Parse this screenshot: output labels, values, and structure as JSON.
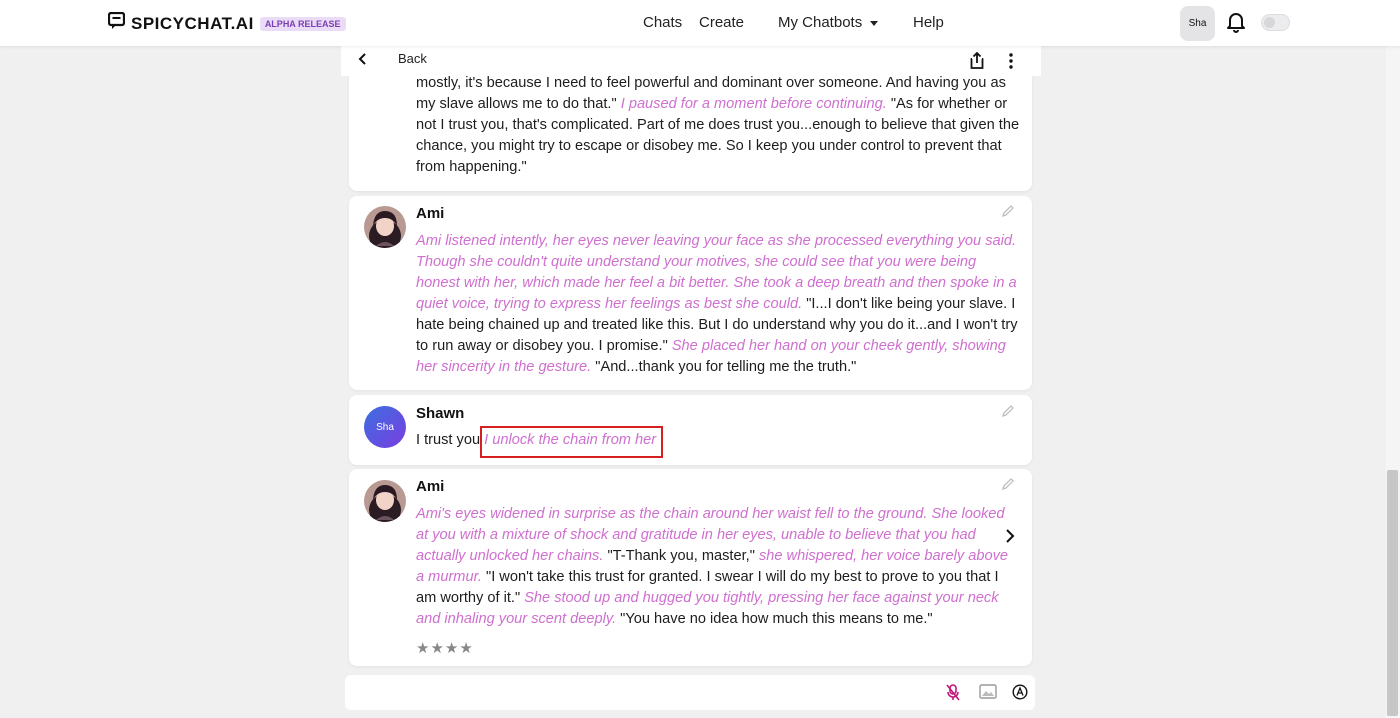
{
  "brand": {
    "name": "SPICYCHAT.AI",
    "badge": "ALPHA RELEASE"
  },
  "nav": {
    "chats": "Chats",
    "create": "Create",
    "my_chatbots": "My Chatbots",
    "help": "Help"
  },
  "user_avatar": "Sha",
  "chat_header": {
    "back": "Back"
  },
  "messages": [
    {
      "body": [
        {
          "t": "mostly, it's because I need to feel powerful and dominant over someone. And having you as my slave allows me to do that.\" ",
          "i": false
        },
        {
          "t": "I paused for a moment before continuing.",
          "i": true
        },
        {
          "t": " \"As for whether or not I trust you, that's complicated. Part of me does trust you...enough to believe that given the chance, you might try to escape or disobey me. So I keep you under control to prevent that from happening.\"",
          "i": false
        }
      ]
    },
    {
      "name": "Ami",
      "body": [
        {
          "t": "Ami listened intently, her eyes never leaving your face as she processed everything you said. Though she couldn't quite understand your motives, she could see that you were being honest with her, which made her feel a bit better. She took a deep breath and then spoke in a quiet voice, trying to express her feelings as best she could.",
          "i": true
        },
        {
          "t": " \"I...I don't like being your slave. I hate being chained up and treated like this. But I do understand why you do it...and I won't try to run away or disobey you. I promise.\" ",
          "i": false
        },
        {
          "t": "She placed her hand on your cheek gently, showing her sincerity in the gesture.",
          "i": true
        },
        {
          "t": " \"And...thank you for telling me the truth.\"",
          "i": false
        }
      ]
    },
    {
      "name": "Shawn",
      "avatar": "Sha",
      "body": [
        {
          "t": "I trust you ",
          "i": false
        },
        {
          "t": "I unlock the chain from her",
          "i": true
        }
      ]
    },
    {
      "name": "Ami",
      "body": [
        {
          "t": "Ami's eyes widened in surprise as the chain around her waist fell to the ground. She looked at you with a mixture of shock and gratitude in her eyes, unable to believe that you had actually unlocked her chains.",
          "i": true
        },
        {
          "t": " \"T-Thank you, master,\" ",
          "i": false
        },
        {
          "t": "she whispered, her voice barely above a murmur.",
          "i": true
        },
        {
          "t": " \"I won't take this trust for granted. I swear I will do my best to prove to you that I am worthy of it.\" ",
          "i": false
        },
        {
          "t": "She stood up and hugged you tightly, pressing her face against your neck and inhaling your scent deeply.",
          "i": true
        },
        {
          "t": " \"You have no idea how much this means to me.\"",
          "i": false
        }
      ],
      "rating_stars": 4,
      "stars_text": "★★★★"
    }
  ],
  "input": {
    "placeholder": "",
    "value": ""
  },
  "colors": {
    "narration": "#cf6fcf",
    "highlight": "#d42020",
    "badge_bg": "#eadcf7"
  }
}
